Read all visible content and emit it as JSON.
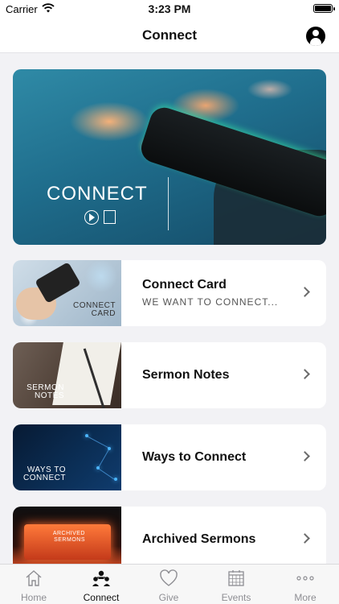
{
  "status_bar": {
    "carrier": "Carrier",
    "time": "3:23 PM"
  },
  "nav": {
    "title": "Connect",
    "profile_icon": "person-circle-icon"
  },
  "hero": {
    "word": "CONNECT"
  },
  "cards": [
    {
      "title": "Connect Card",
      "subtitle": "WE WANT TO CONNECT...",
      "thumb_text": [
        "CONNECT",
        "CARD"
      ]
    },
    {
      "title": "Sermon Notes",
      "subtitle": "",
      "thumb_text": [
        "SERMON",
        "NOTES"
      ]
    },
    {
      "title": "Ways to Connect",
      "subtitle": "",
      "thumb_text": [
        "WAYS TO",
        "CONNECT"
      ]
    },
    {
      "title": "Archived  Sermons",
      "subtitle": "",
      "thumb_text": [
        "ARCHIVED",
        "SERMONS"
      ]
    }
  ],
  "tabs": [
    {
      "label": "Home",
      "icon": "home-icon",
      "active": false
    },
    {
      "label": "Connect",
      "icon": "people-icon",
      "active": true
    },
    {
      "label": "Give",
      "icon": "heart-icon",
      "active": false
    },
    {
      "label": "Events",
      "icon": "calendar-icon",
      "active": false
    },
    {
      "label": "More",
      "icon": "more-icon",
      "active": false
    }
  ],
  "colors": {
    "background": "#f2f2f5",
    "active_tab": "#111111",
    "inactive_tab": "#8e8e93",
    "hero_teal": "#1f6d8c"
  }
}
